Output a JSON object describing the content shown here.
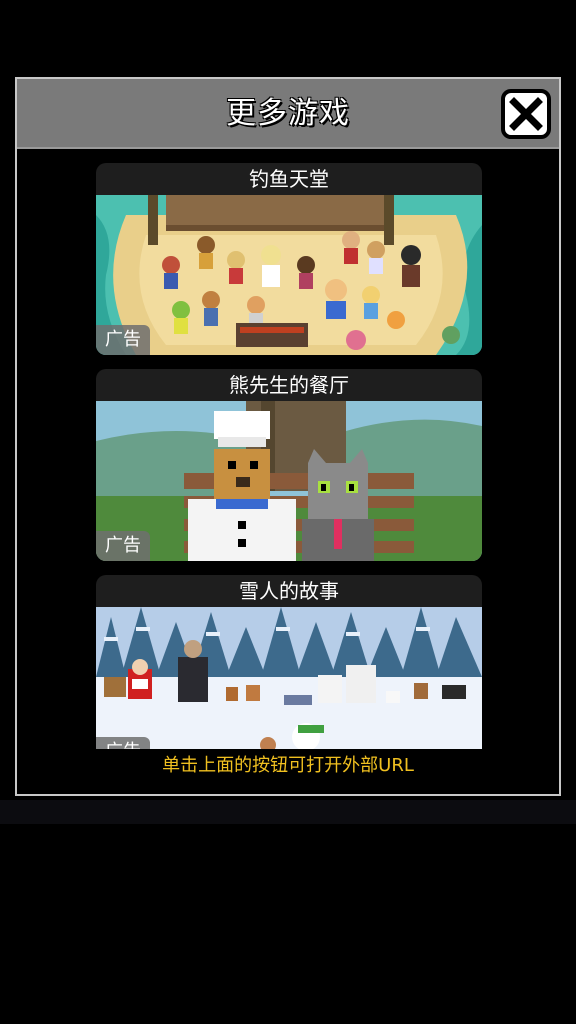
{
  "dialog": {
    "title": "更多游戏",
    "close_icon": "close-x-icon",
    "footer_hint": "单击上面的按钮可打开外部URL"
  },
  "games": [
    {
      "title": "钓鱼天堂",
      "ad_label": "广告"
    },
    {
      "title": "熊先生的餐厅",
      "ad_label": "广告"
    },
    {
      "title": "雪人的故事",
      "ad_label": "广告"
    }
  ],
  "colors": {
    "header_bg": "#7a7a7a",
    "hint_text": "#f0c020",
    "card_bg": "#1e1e1e"
  }
}
